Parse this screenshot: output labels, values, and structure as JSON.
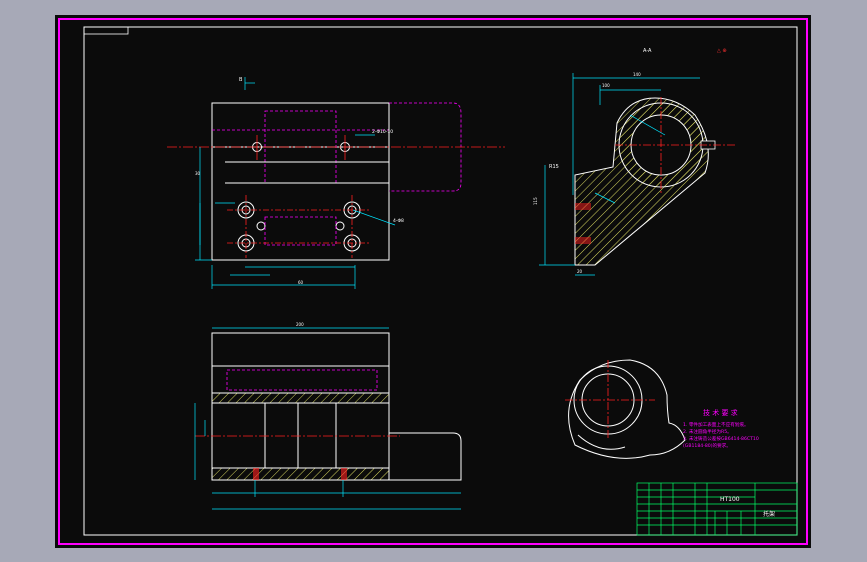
{
  "title_block": {
    "material": "HT100",
    "part_name": "托架"
  },
  "technical_requirements": {
    "heading": "技 术 要 求",
    "items": [
      "1. 零件加工表面上不应有划痕。",
      "2. 未注圆角半径为R5。",
      "3. 未注铸造公差按GB6414-86CT10",
      "(GB1184-80)的要求。"
    ]
  },
  "dimensions": {
    "section_a": "A-A",
    "leader_top": "B",
    "hole_callout": "2-Φ10-10",
    "hole_callout2": "4-Φ8",
    "dim_140": "140",
    "dim_100": "100",
    "dim_r15": "R15",
    "dim_115": "115",
    "dim_200": "200",
    "dim_30": "30",
    "dim_60": "60",
    "dim_20": "20"
  },
  "colors": {
    "background": "#0b0b0b",
    "outline": "#ffffff",
    "dimension": "#00e5ff",
    "hidden": "#ff00ff",
    "center": "#ff2020",
    "hatch": "#d8d860",
    "border": "#ff00ff",
    "text_red": "#ff3030",
    "frame": "#ffffff"
  }
}
